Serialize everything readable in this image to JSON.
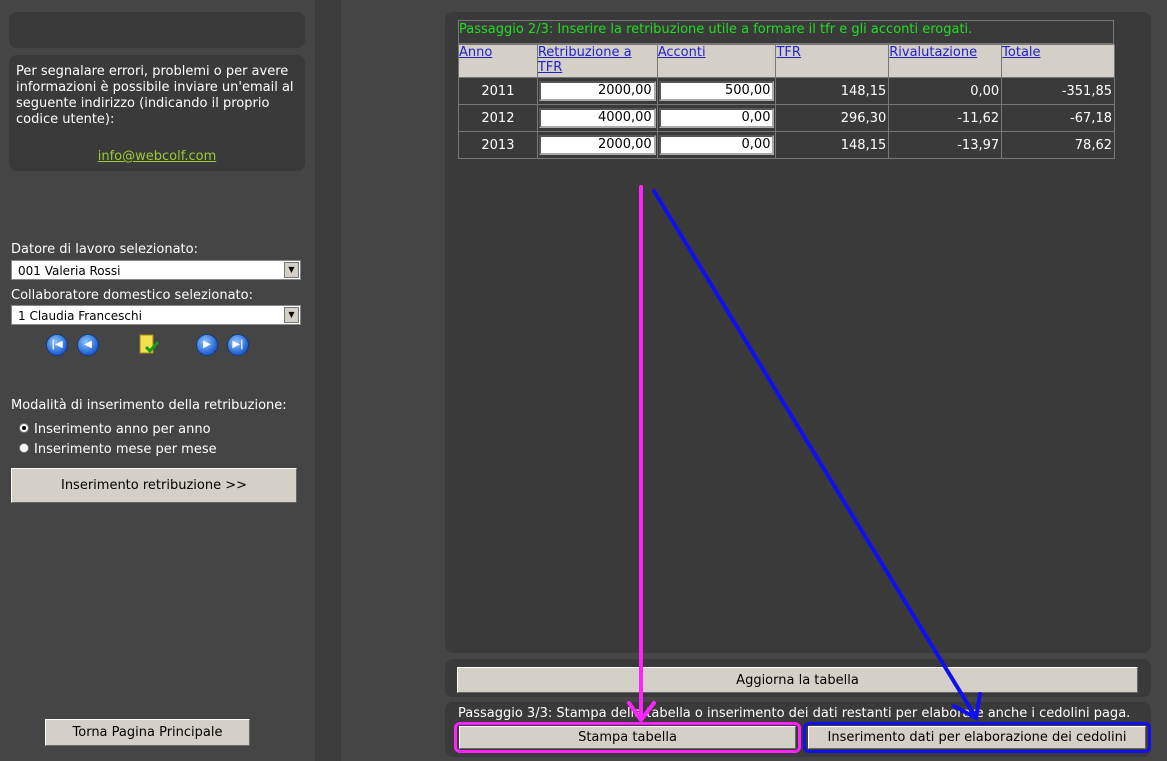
{
  "sidebar": {
    "info_text": "Per segnalare errori, problemi o per avere informazioni è possibile inviare un'email al seguente indirizzo (indicando il proprio codice utente):",
    "email": "info@webcolf.com",
    "employer_label": "Datore di lavoro selezionato:",
    "employer_value": "001 Valeria Rossi",
    "worker_label": "Collaboratore domestico selezionato:",
    "worker_value": "1 Claudia Franceschi",
    "mode_label": "Modalità di inserimento della retribuzione:",
    "mode_options": [
      "Inserimento anno per anno",
      "Inserimento mese per mese"
    ],
    "mode_selected": "Inserimento anno per anno",
    "insert_button": "Inserimento retribuzione >>",
    "home_button": "Torna Pagina Principale"
  },
  "main": {
    "step2_text": "Passaggio 2/3: Inserire la retribuzione utile a formare il tfr e gli acconti erogati.",
    "columns": [
      "Anno",
      "Retribuzione a TFR",
      "Acconti",
      "TFR",
      "Rivalutazione",
      "Totale"
    ],
    "rows": [
      {
        "anno": "2011",
        "retribuzione": "2000,00",
        "acconti": "500,00",
        "tfr": "148,15",
        "rivalutazione": "0,00",
        "totale": "-351,85"
      },
      {
        "anno": "2012",
        "retribuzione": "4000,00",
        "acconti": "0,00",
        "tfr": "296,30",
        "rivalutazione": "-11,62",
        "totale": "-67,18"
      },
      {
        "anno": "2013",
        "retribuzione": "2000,00",
        "acconti": "0,00",
        "tfr": "148,15",
        "rivalutazione": "-13,97",
        "totale": "78,62"
      }
    ],
    "update_button": "Aggiorna la tabella",
    "step3_text": "Passaggio 3/3: Stampa della tabella o inserimento dei dati restanti per elaborare anche i cedolini paga.",
    "print_button": "Stampa tabella",
    "payslip_button": "Inserimento dati per elaborazione dei cedolini"
  },
  "annotation_colors": {
    "magenta": "#ff22ff",
    "blue": "#1010ee"
  }
}
